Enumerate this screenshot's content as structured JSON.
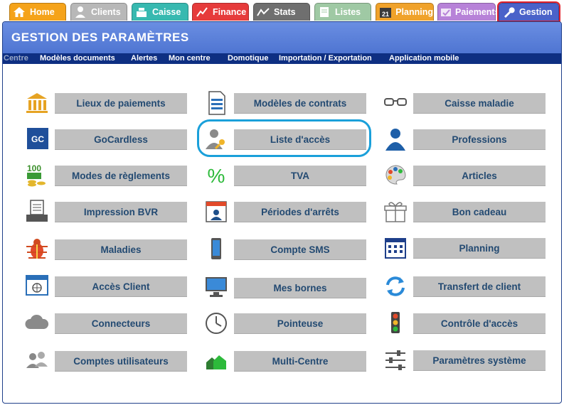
{
  "tabs": [
    {
      "label": "Home",
      "color": "#f5a31a"
    },
    {
      "label": "Clients",
      "color": "#b8b8b8"
    },
    {
      "label": "Caisse",
      "color": "#37b9b0"
    },
    {
      "label": "Finance",
      "color": "#e63b3b"
    },
    {
      "label": "Stats",
      "color": "#7a7a7a"
    },
    {
      "label": "Listes",
      "color": "#9fc9a4"
    },
    {
      "label": "Planning",
      "color": "#f0a22a"
    },
    {
      "label": "Paiements",
      "color": "#b782d8"
    },
    {
      "label": "Gestion",
      "color": "#4a62c9"
    }
  ],
  "panel": {
    "title": "GESTION DES PARAMÈTRES"
  },
  "subnav": [
    "Centre",
    "Modèles documents",
    "Alertes",
    "Mon centre",
    "Domotique",
    "Importation / Exportation",
    "Application mobile"
  ],
  "grid": {
    "col1": [
      "Lieux de paiements",
      "GoCardless",
      "Modes de règlements",
      "Impression BVR",
      "Maladies",
      "Accès Client",
      "Connecteurs",
      "Comptes utilisateurs"
    ],
    "col2": [
      "Modèles de contrats",
      "Liste d'accès",
      "TVA",
      "Périodes d'arrêts",
      "Compte SMS",
      "Mes bornes",
      "Pointeuse",
      "Multi-Centre"
    ],
    "col3": [
      "Caisse maladie",
      "Professions",
      "Articles",
      "Bon cadeau",
      "Planning",
      "Transfert de client",
      "Contrôle d'accès",
      "Paramètres système"
    ]
  },
  "icons": {
    "gocardless_text": "GC",
    "tva_text": "%",
    "modes_text": "100"
  }
}
